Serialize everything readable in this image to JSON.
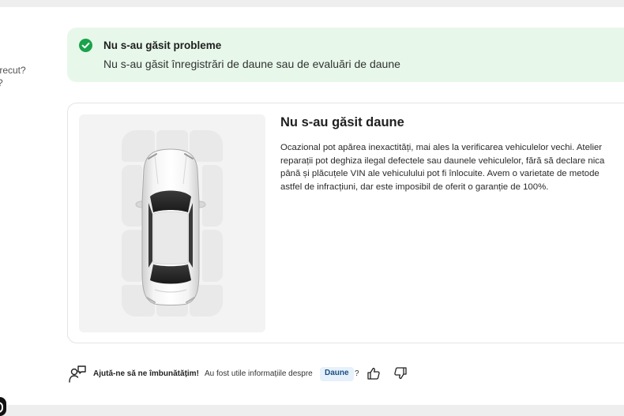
{
  "left_fragment": {
    "line1": "trecut?",
    "line2": "?"
  },
  "alert": {
    "title": "Nu s-au găsit probleme",
    "subtitle": "Nu s-au găsit înregistrări de daune sau de evaluări de daune",
    "icon": "check-circle-icon",
    "color": "#1aa34a"
  },
  "damage_card": {
    "heading": "Nu s-au găsit daune",
    "description_lines": [
      "Ocazional pot apărea inexactități, mai ales la verificarea vehiculelor vechi. Atelier",
      "reparații pot deghiza ilegal defectele sau daunele vehiculelor, fără să declare nica",
      "până și plăcuțele VIN ale vehiculului pot fi înlocuite. Avem o varietate de metode",
      "astfel de infracțiuni, dar este imposibil de oferit o garanție de 100%."
    ]
  },
  "feedback": {
    "prompt": "Ajută-ne să ne îmbunătățim!",
    "question": "Au fost utile informațiile despre",
    "topic_badge": "Daune",
    "question_mark": "?"
  }
}
